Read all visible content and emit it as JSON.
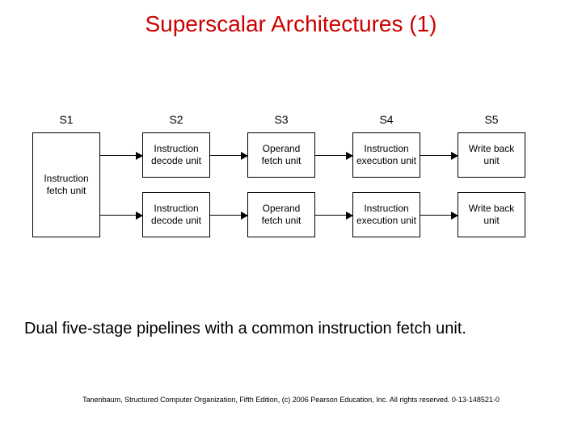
{
  "title": "Superscalar Architectures (1)",
  "stage_labels": [
    "S1",
    "S2",
    "S3",
    "S4",
    "S5"
  ],
  "s1_box": "Instruction fetch unit",
  "pipeline_boxes": [
    "Instruction decode unit",
    "Operand fetch unit",
    "Instruction execution unit",
    "Write back unit"
  ],
  "caption": "Dual five-stage pipelines with a common instruction fetch unit.",
  "footer": "Tanenbaum, Structured Computer Organization, Fifth Edition, (c) 2006 Pearson Education, Inc. All rights reserved. 0-13-148521-0"
}
